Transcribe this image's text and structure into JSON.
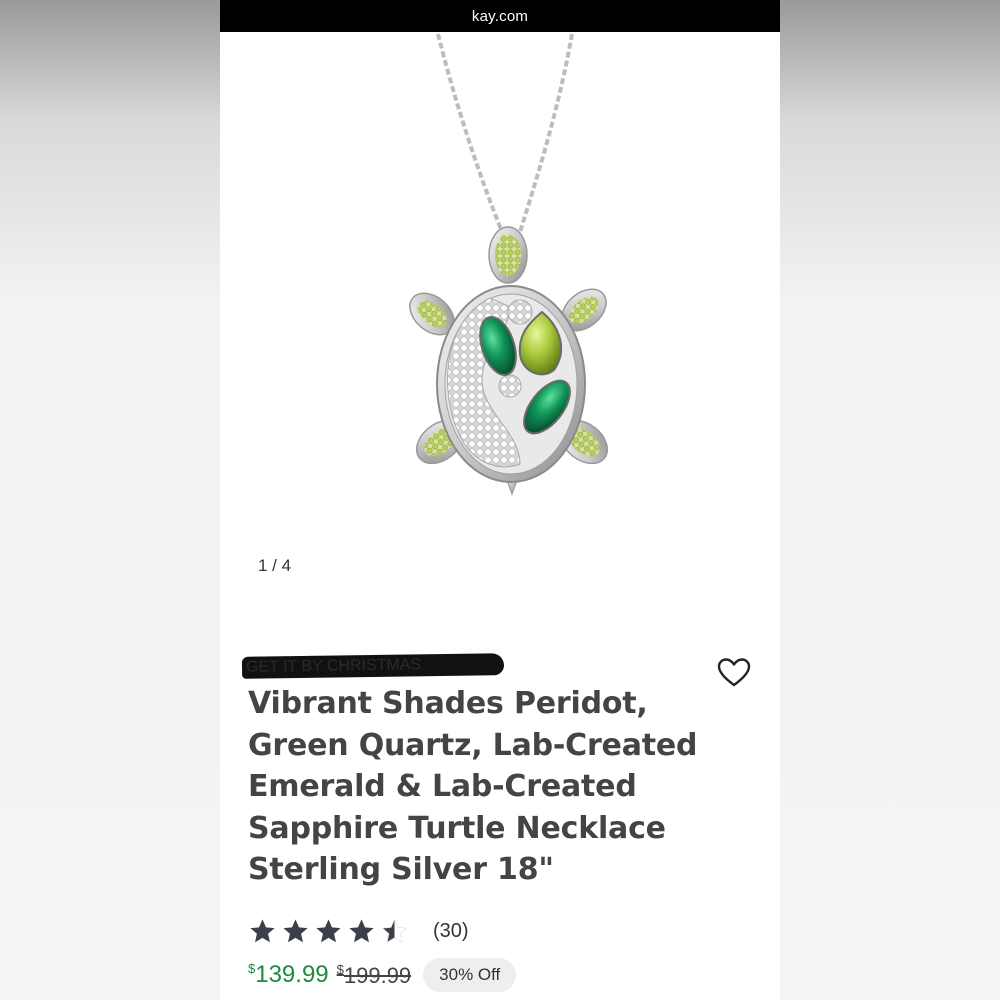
{
  "browser": {
    "url": "kay.com"
  },
  "gallery": {
    "pager": "1 / 4"
  },
  "product": {
    "badge": "GET IT BY CHRISTMAS",
    "title": "Vibrant Shades Peridot, Green Quartz, Lab-Created Emerald & Lab-Created Sapphire Turtle Necklace Sterling Silver 18\"",
    "rating": 4.5,
    "review_count": "(30)",
    "price": {
      "currency": "$",
      "sale": "139.99",
      "original": "199.99",
      "discount": "30% Off"
    }
  },
  "colors": {
    "sale_price": "#1e8a3c",
    "star": "#3a3f4a",
    "url_bar": "#000000"
  },
  "icons": {
    "wishlist": "heart-outline-icon",
    "rating": "star-icon"
  }
}
